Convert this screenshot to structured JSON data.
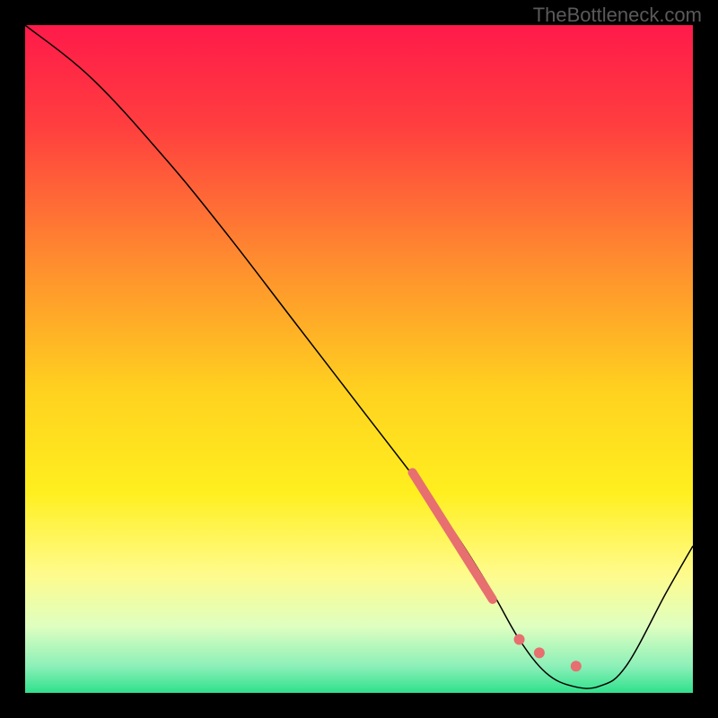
{
  "watermark": "TheBottleneck.com",
  "chart_data": {
    "type": "line",
    "title": "",
    "xlabel": "",
    "ylabel": "",
    "xlim": [
      0,
      100
    ],
    "ylim": [
      0,
      100
    ],
    "grid": false,
    "background": {
      "type": "vertical-gradient",
      "stops": [
        {
          "pos": 0.0,
          "color": "#ff1a4a"
        },
        {
          "pos": 0.15,
          "color": "#ff3e3f"
        },
        {
          "pos": 0.35,
          "color": "#ff8b2f"
        },
        {
          "pos": 0.55,
          "color": "#ffd21f"
        },
        {
          "pos": 0.7,
          "color": "#ffef1f"
        },
        {
          "pos": 0.82,
          "color": "#fffb8a"
        },
        {
          "pos": 0.9,
          "color": "#dfffc0"
        },
        {
          "pos": 0.96,
          "color": "#8cf0b8"
        },
        {
          "pos": 1.0,
          "color": "#2fe08c"
        }
      ]
    },
    "series": [
      {
        "name": "bottleneck-curve",
        "stroke": "#000000",
        "stroke_width": 1.5,
        "x": [
          0,
          10,
          21,
          30,
          40,
          50,
          60,
          65,
          70,
          74,
          78,
          82,
          86,
          90,
          96,
          100
        ],
        "y": [
          100,
          92,
          80,
          69,
          56,
          43,
          30,
          23,
          15,
          8,
          3,
          1,
          1,
          4,
          15,
          22
        ]
      }
    ],
    "highlight_segment": {
      "name": "highlighted-region",
      "stroke": "#e76f6f",
      "stroke_width": 10,
      "linecap": "round",
      "x": [
        58,
        70
      ],
      "y": [
        33,
        14
      ]
    },
    "highlight_dots": {
      "name": "highlight-dots",
      "fill": "#e76f6f",
      "r": 6,
      "points": [
        {
          "x": 74,
          "y": 8
        },
        {
          "x": 77,
          "y": 6
        },
        {
          "x": 82.5,
          "y": 4
        }
      ]
    }
  }
}
